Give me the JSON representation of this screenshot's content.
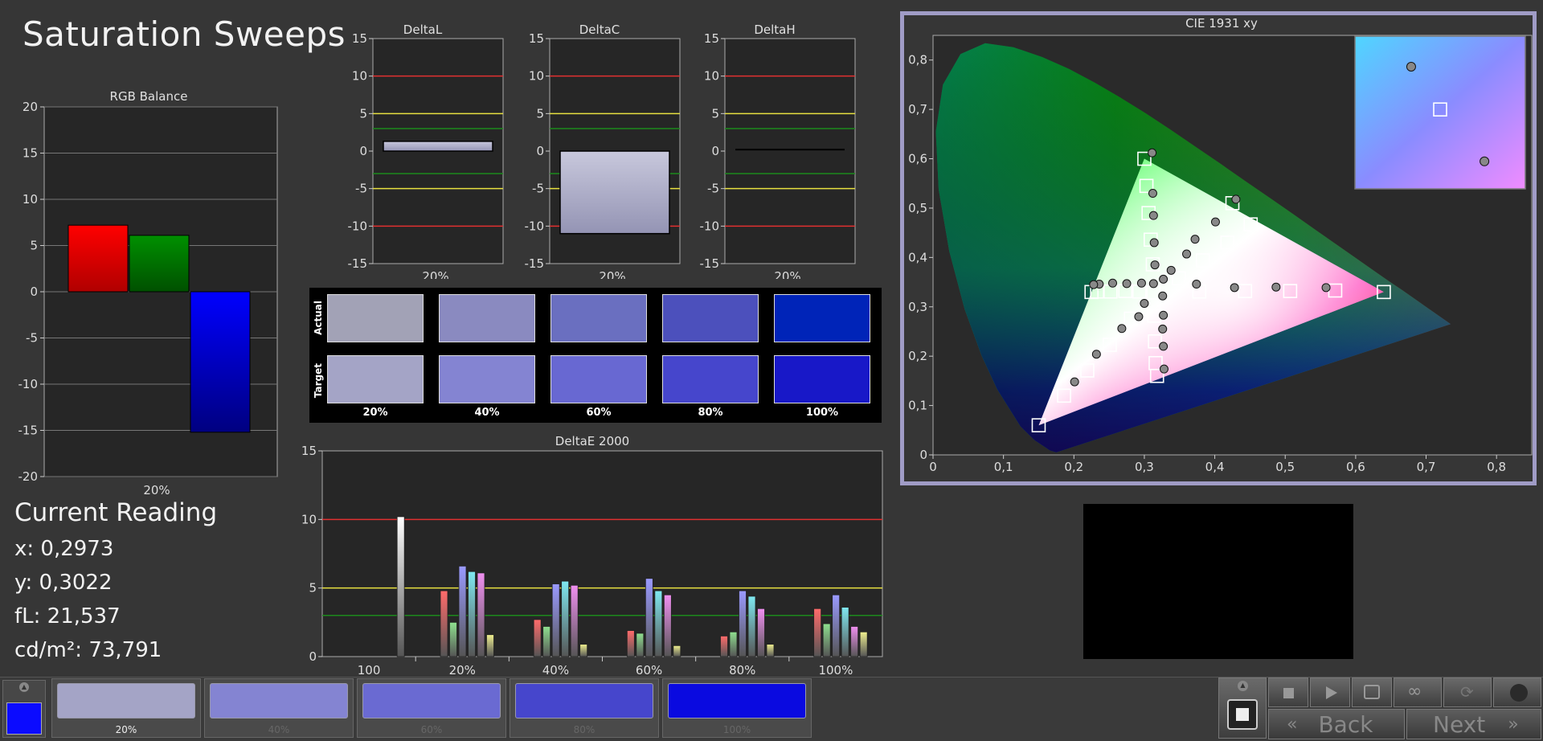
{
  "page": {
    "title": "Saturation Sweeps"
  },
  "reading": {
    "title": "Current Reading",
    "x": "x: 0,2973",
    "y": "y: 0,3022",
    "fl": "fL: 21,537",
    "cdm2": "cd/m²: 73,791"
  },
  "chart_data": [
    {
      "type": "bar",
      "title": "RGB Balance",
      "categories": [
        "20%"
      ],
      "series": [
        {
          "name": "",
          "values": [
            7.2
          ],
          "color": "#ff0000"
        },
        {
          "name": "",
          "values": [
            6.1
          ],
          "color": "#009000"
        },
        {
          "name": "",
          "values": [
            -15.2
          ],
          "color": "#0000ff"
        }
      ],
      "ylim": [
        -20,
        20
      ],
      "yticks": [
        "20",
        "15",
        "10",
        "5",
        "0",
        "-5",
        "-10",
        "-15",
        "-20"
      ],
      "grid": true
    },
    {
      "type": "bar",
      "title": "DeltaL",
      "categories": [
        "20%"
      ],
      "values": [
        1.3
      ],
      "ylim": [
        -15,
        15
      ],
      "yticks": [
        "15",
        "10",
        "5",
        "0",
        "-5",
        "-10",
        "-15"
      ]
    },
    {
      "type": "bar",
      "title": "DeltaC",
      "categories": [
        "20%"
      ],
      "values": [
        -11
      ],
      "ylim": [
        -15,
        15
      ],
      "yticks": [
        "15",
        "10",
        "5",
        "0",
        "-5",
        "-10",
        "-15"
      ]
    },
    {
      "type": "bar",
      "title": "DeltaH",
      "categories": [
        "20%"
      ],
      "values": [
        0.2
      ],
      "ylim": [
        -15,
        15
      ],
      "yticks": [
        "15",
        "10",
        "5",
        "0",
        "-5",
        "-10",
        "-15"
      ]
    },
    {
      "type": "bar",
      "title": "DeltaE 2000",
      "categories": [
        "100",
        "20%",
        "40%",
        "60%",
        "80%",
        "100%"
      ],
      "series_colors": [
        "#ff6b6b",
        "#8fe08f",
        "#9a9aff",
        "#7fe8f0",
        "#f08ff0",
        "#f0f08f"
      ],
      "groups": [
        [
          10.2
        ],
        [
          4.8,
          2.5,
          6.6,
          6.2,
          6.1,
          1.6
        ],
        [
          2.7,
          2.2,
          5.3,
          5.5,
          5.2,
          0.9
        ],
        [
          1.9,
          1.7,
          5.7,
          4.8,
          4.5,
          0.8
        ],
        [
          1.5,
          1.8,
          4.8,
          4.4,
          3.5,
          0.9
        ],
        [
          3.5,
          2.4,
          4.5,
          3.6,
          2.2,
          1.8
        ]
      ],
      "ylim": [
        0,
        15
      ],
      "yticks": [
        "15",
        "10",
        "5",
        "0"
      ]
    },
    {
      "type": "scatter",
      "title": "CIE 1931 xy",
      "xlim": [
        0,
        0.85
      ],
      "ylim": [
        0,
        0.85
      ],
      "xticks": [
        "0",
        "0,1",
        "0,2",
        "0,3",
        "0,4",
        "0,5",
        "0,6",
        "0,7",
        "0,8"
      ],
      "yticks": [
        "0",
        "0,1",
        "0,2",
        "0,3",
        "0,4",
        "0,5",
        "0,6",
        "0,7",
        "0,8"
      ],
      "gamut": [
        [
          0.64,
          0.33
        ],
        [
          0.3,
          0.6
        ],
        [
          0.15,
          0.06
        ]
      ],
      "targets": [
        [
          0.313,
          0.329
        ],
        [
          0.378,
          0.331
        ],
        [
          0.443,
          0.332
        ],
        [
          0.507,
          0.332
        ],
        [
          0.571,
          0.333
        ],
        [
          0.64,
          0.33
        ],
        [
          0.312,
          0.386
        ],
        [
          0.309,
          0.436
        ],
        [
          0.306,
          0.49
        ],
        [
          0.303,
          0.545
        ],
        [
          0.3,
          0.6
        ],
        [
          0.349,
          0.358
        ],
        [
          0.383,
          0.394
        ],
        [
          0.418,
          0.43
        ],
        [
          0.451,
          0.467
        ],
        [
          0.425,
          0.51
        ],
        [
          0.293,
          0.331
        ],
        [
          0.273,
          0.332
        ],
        [
          0.252,
          0.331
        ],
        [
          0.233,
          0.331
        ],
        [
          0.225,
          0.33
        ],
        [
          0.281,
          0.276
        ],
        [
          0.251,
          0.223
        ],
        [
          0.219,
          0.171
        ],
        [
          0.186,
          0.12
        ],
        [
          0.15,
          0.06
        ],
        [
          0.314,
          0.282
        ],
        [
          0.315,
          0.23
        ],
        [
          0.316,
          0.186
        ],
        [
          0.318,
          0.16
        ]
      ],
      "measured": [
        [
          0.313,
          0.347
        ],
        [
          0.374,
          0.346
        ],
        [
          0.428,
          0.339
        ],
        [
          0.487,
          0.34
        ],
        [
          0.558,
          0.339
        ],
        [
          0.315,
          0.385
        ],
        [
          0.314,
          0.43
        ],
        [
          0.313,
          0.485
        ],
        [
          0.312,
          0.53
        ],
        [
          0.311,
          0.612
        ],
        [
          0.327,
          0.356
        ],
        [
          0.338,
          0.374
        ],
        [
          0.36,
          0.407
        ],
        [
          0.372,
          0.437
        ],
        [
          0.401,
          0.472
        ],
        [
          0.43,
          0.518
        ],
        [
          0.296,
          0.348
        ],
        [
          0.275,
          0.347
        ],
        [
          0.255,
          0.348
        ],
        [
          0.236,
          0.346
        ],
        [
          0.228,
          0.345
        ],
        [
          0.3,
          0.307
        ],
        [
          0.292,
          0.28
        ],
        [
          0.268,
          0.256
        ],
        [
          0.232,
          0.204
        ],
        [
          0.201,
          0.148
        ],
        [
          0.326,
          0.322
        ],
        [
          0.327,
          0.283
        ],
        [
          0.326,
          0.255
        ],
        [
          0.327,
          0.22
        ],
        [
          0.328,
          0.174
        ]
      ],
      "inset_targets": [
        [
          0.5,
          0.52
        ]
      ],
      "inset_measured": [
        [
          0.76,
          0.18
        ],
        [
          0.33,
          0.8
        ]
      ]
    }
  ],
  "swatches": {
    "actual_label": "Actual",
    "target_label": "Target",
    "labels": [
      "20%",
      "40%",
      "60%",
      "80%",
      "100%"
    ],
    "actual_colors": [
      "#a2a2b6",
      "#8a8ac0",
      "#6a6fc0",
      "#4c50bc",
      "#0024b8"
    ],
    "target_colors": [
      "#a4a4c6",
      "#8484d2",
      "#6868d2",
      "#4646cc",
      "#1818c8"
    ]
  },
  "strip": {
    "labels": [
      "20%",
      "40%",
      "60%",
      "80%",
      "100%"
    ],
    "colors": [
      "#a4a4c6",
      "#8484d2",
      "#6a6ad2",
      "#4646cc",
      "#0a0ae0"
    ],
    "current_color": "#0b0bff"
  },
  "controls": {
    "back_label": "Back",
    "next_label": "Next"
  }
}
